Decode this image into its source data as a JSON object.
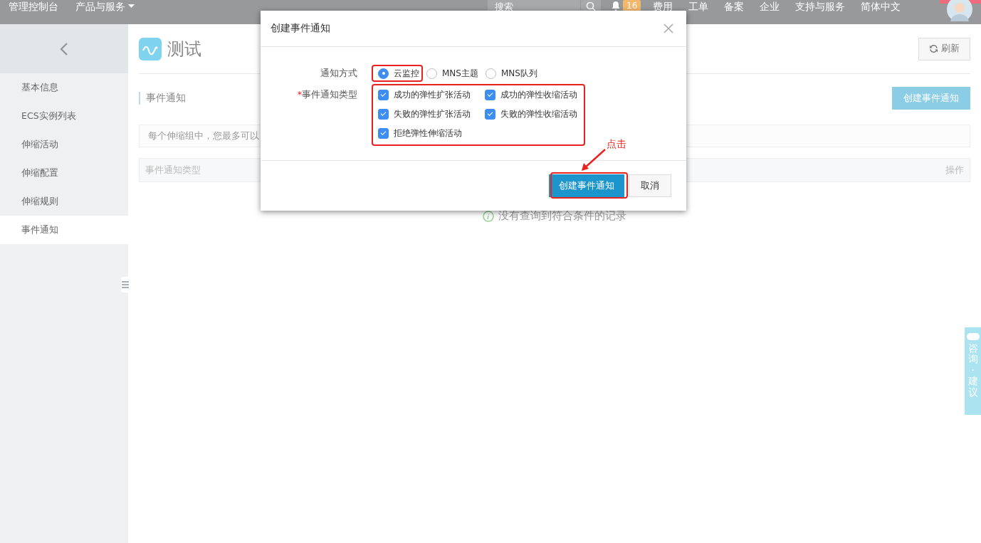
{
  "top_nav": {
    "console": "管理控制台",
    "products": "产品与服务",
    "search": {
      "placeholder": "搜索"
    },
    "notification_count": "16",
    "links": [
      "费用",
      "工单",
      "备案",
      "企业",
      "支持与服务",
      "简体中文"
    ]
  },
  "sidebar": {
    "items": [
      {
        "label": "基本信息",
        "selected": false
      },
      {
        "label": "ECS实例列表",
        "selected": false
      },
      {
        "label": "伸缩活动",
        "selected": false
      },
      {
        "label": "伸缩配置",
        "selected": false
      },
      {
        "label": "伸缩规则",
        "selected": false
      },
      {
        "label": "事件通知",
        "selected": true
      }
    ]
  },
  "page": {
    "title": "测试",
    "refresh_button": "刷新",
    "section_title": "事件通知",
    "create_button": "创建事件通知",
    "notice": "每个伸缩组中，您最多可以",
    "table": {
      "columns": [
        "事件通知类型",
        "操作"
      ]
    },
    "empty_message": "没有查询到符合条件的记录"
  },
  "modal": {
    "title": "创建事件通知",
    "notify_method": {
      "label": "通知方式",
      "options": [
        {
          "label": "云监控",
          "selected": true
        },
        {
          "label": "MNS主题",
          "selected": false
        },
        {
          "label": "MNS队列",
          "selected": false
        }
      ]
    },
    "event_types": {
      "label": "事件通知类型",
      "required_mark": "*",
      "options": [
        {
          "label": "成功的弹性扩张活动",
          "checked": true
        },
        {
          "label": "成功的弹性收缩活动",
          "checked": true
        },
        {
          "label": "失败的弹性扩张活动",
          "checked": true
        },
        {
          "label": "失败的弹性收缩活动",
          "checked": true
        },
        {
          "label": "拒绝弹性伸缩活动",
          "checked": true
        }
      ]
    },
    "submit_button": "创建事件通知",
    "cancel_button": "取消"
  },
  "annotation": {
    "label": "点击"
  },
  "feedback_tab": {
    "label": "咨询·建议"
  }
}
